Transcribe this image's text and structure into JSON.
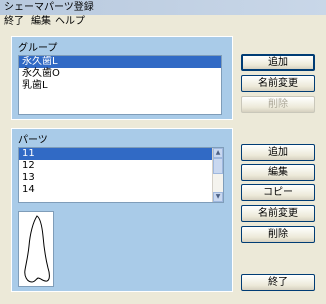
{
  "window": {
    "title": "シェーマパーツ登録"
  },
  "menu": [
    "終了",
    "編集",
    "ヘルプ"
  ],
  "group": {
    "label": "グループ",
    "items": [
      {
        "label": "永久歯L",
        "selected": true
      },
      {
        "label": "永久歯O",
        "selected": false
      },
      {
        "label": "乳歯L",
        "selected": false
      }
    ],
    "buttons": {
      "add": "追加",
      "rename": "名前変更",
      "delete": "削除"
    }
  },
  "parts": {
    "label": "パーツ",
    "items": [
      {
        "label": "11",
        "selected": true
      },
      {
        "label": "12",
        "selected": false
      },
      {
        "label": "13",
        "selected": false
      },
      {
        "label": "14",
        "selected": false
      }
    ],
    "buttons": {
      "add": "追加",
      "edit": "編集",
      "copy": "コピー",
      "rename": "名前変更",
      "delete": "削除"
    }
  },
  "footer": {
    "exit": "終了"
  },
  "colors": {
    "panel": "#a9cbe8",
    "selection": "#316ac5",
    "window": "#ece9d8"
  }
}
